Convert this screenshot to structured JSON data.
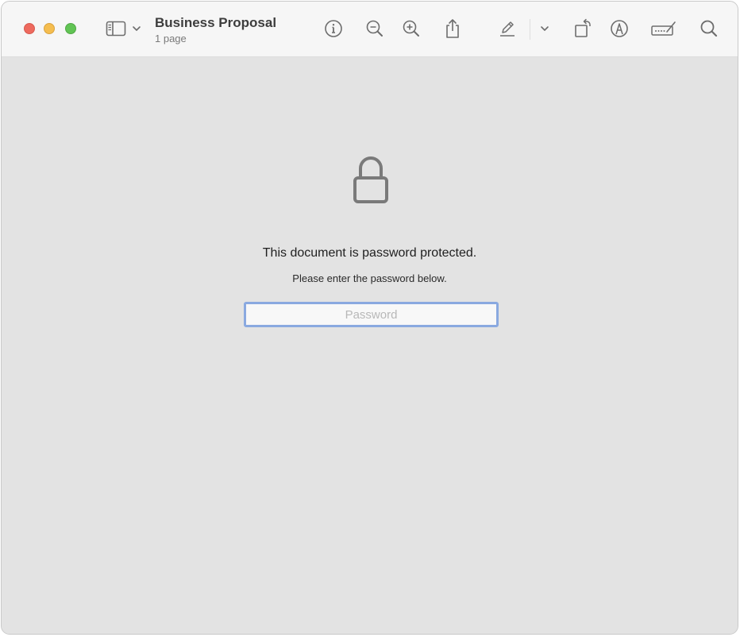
{
  "window": {
    "title": "Business Proposal",
    "subtitle": "1 page"
  },
  "toolbar": {
    "icons": [
      "sidebar-toggle-icon",
      "chevron-down-icon",
      "info-icon",
      "zoom-out-icon",
      "zoom-in-icon",
      "share-icon",
      "highlight-pen-icon",
      "chevron-down-icon",
      "rotate-icon",
      "markup-icon",
      "form-fill-icon",
      "search-icon"
    ]
  },
  "content": {
    "icon": "lock-icon",
    "heading": "This document is password protected.",
    "subtext": "Please enter the password below.",
    "password": {
      "placeholder": "Password",
      "value": ""
    }
  },
  "colors": {
    "close": "#ee6a5e",
    "minimize": "#f5bd4f",
    "zoom": "#61c454",
    "focus_ring": "#8aa9e0",
    "background": "#e3e3e3"
  }
}
